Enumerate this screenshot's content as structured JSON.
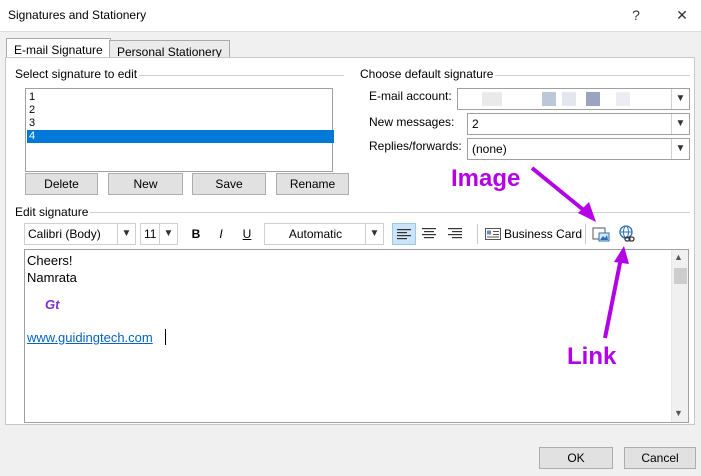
{
  "window": {
    "title": "Signatures and Stationery",
    "help": "?",
    "close": "✕"
  },
  "tabs": [
    {
      "label": "E-mail Signature",
      "active": true
    },
    {
      "label": "Personal Stationery",
      "active": false
    }
  ],
  "select_signature": {
    "label": "Select signature to edit",
    "items": [
      "1",
      "2",
      "3",
      "4"
    ],
    "selected": "4"
  },
  "buttons": {
    "delete": "Delete",
    "new": "New",
    "save": "Save",
    "rename": "Rename"
  },
  "defaults": {
    "label": "Choose default signature",
    "email_account_label": "E-mail account:",
    "email_account_value": "",
    "new_messages_label": "New messages:",
    "new_messages_value": "2",
    "replies_label": "Replies/forwards:",
    "replies_value": "(none)"
  },
  "edit_signature": {
    "label": "Edit signature",
    "font": "Calibri (Body)",
    "size": "11",
    "bold": "B",
    "italic": "I",
    "underline": "U",
    "color": "Automatic",
    "business_card": "Business Card",
    "content": {
      "line1": "Cheers!",
      "line2": "Namrata",
      "logo": "Gt",
      "link": "www.guidingtech.com"
    }
  },
  "annotations": {
    "image": "Image",
    "link": "Link",
    "color": "#b400e6"
  },
  "footer": {
    "ok": "OK",
    "cancel": "Cancel"
  },
  "colors": {
    "selection": "#0078d7",
    "link": "#0563c1",
    "accent": "#b400e6"
  }
}
